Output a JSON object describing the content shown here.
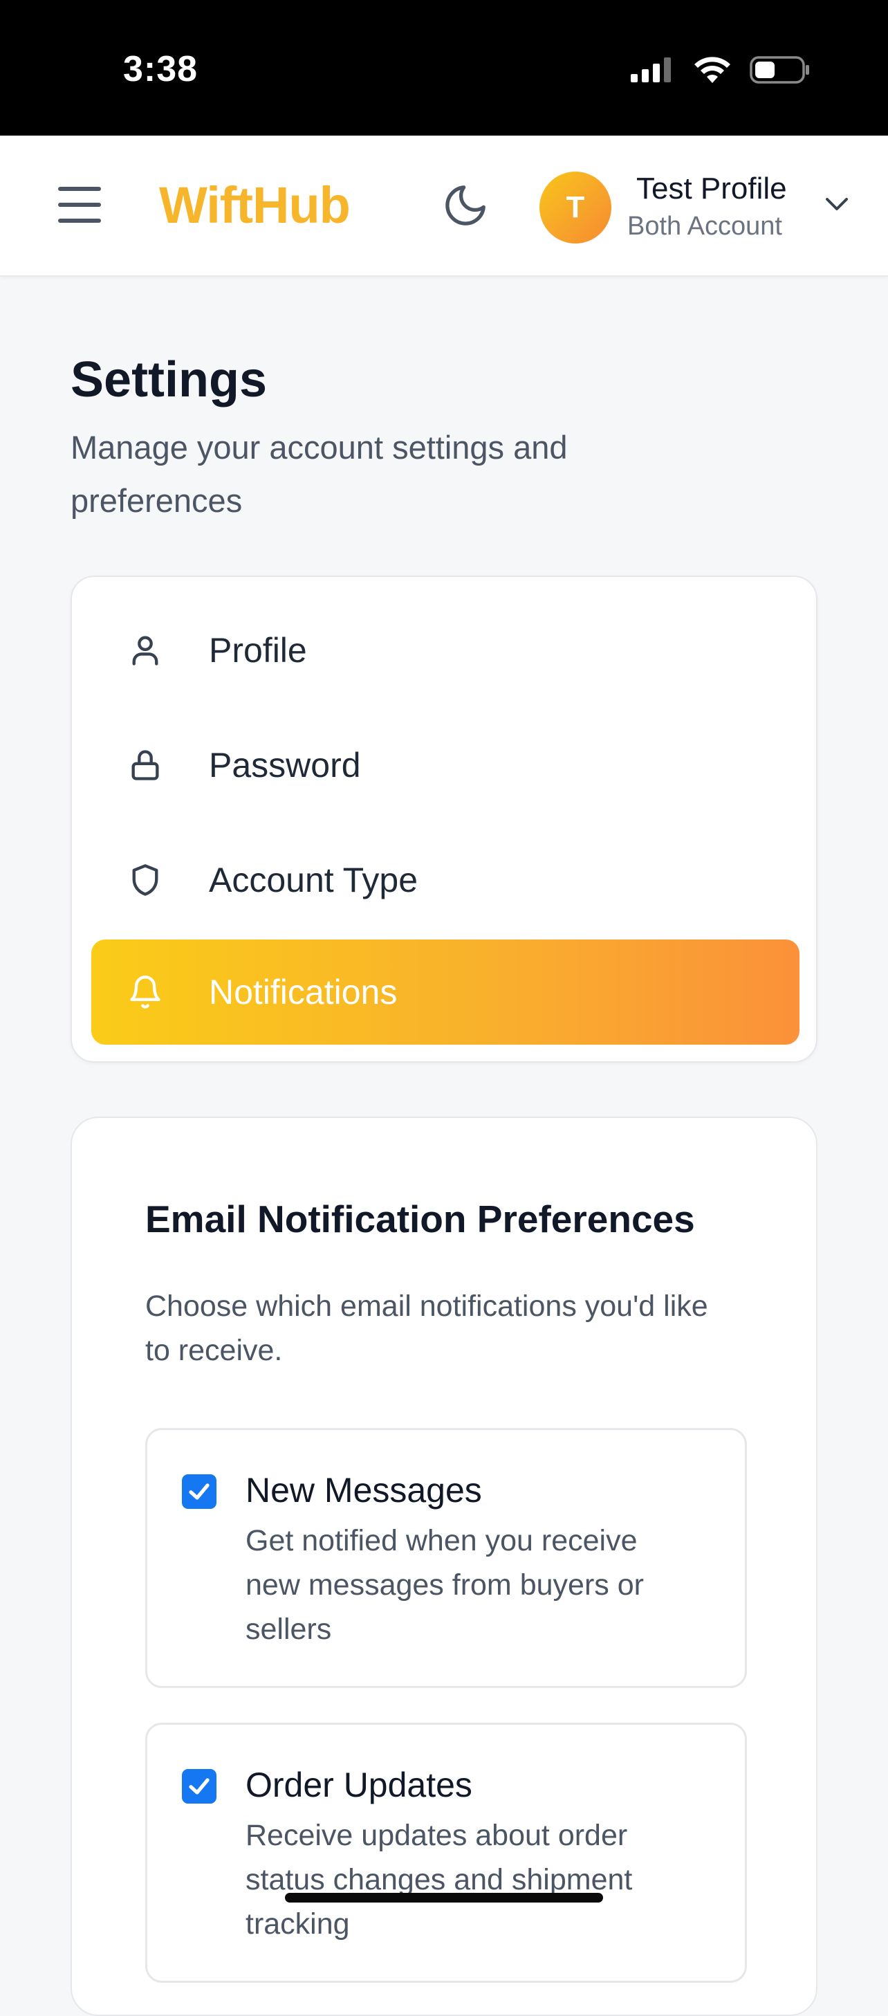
{
  "status_bar": {
    "time": "3:38"
  },
  "header": {
    "brand": "WiftHub",
    "avatar_initial": "T",
    "profile_name": "Test Profile",
    "profile_account": "Both Account",
    "brand_color": "#f7b52b"
  },
  "page": {
    "title": "Settings",
    "subtitle": "Manage your account settings and preferences"
  },
  "nav": {
    "items": [
      {
        "label": "Profile",
        "icon": "user-icon"
      },
      {
        "label": "Password",
        "icon": "lock-icon"
      },
      {
        "label": "Account Type",
        "icon": "shield-icon"
      },
      {
        "label": "Notifications",
        "icon": "bell-icon",
        "active": true
      }
    ]
  },
  "preferences": {
    "title": "Email Notification Preferences",
    "description": "Choose which email notifications you'd like to receive.",
    "items": [
      {
        "label": "New Messages",
        "text": "Get notified when you receive new messages from buyers or sellers",
        "checked": true
      },
      {
        "label": "Order Updates",
        "text": "Receive updates about order status changes and shipment tracking",
        "checked": true
      }
    ],
    "checkbox_color": "#1677f2"
  }
}
